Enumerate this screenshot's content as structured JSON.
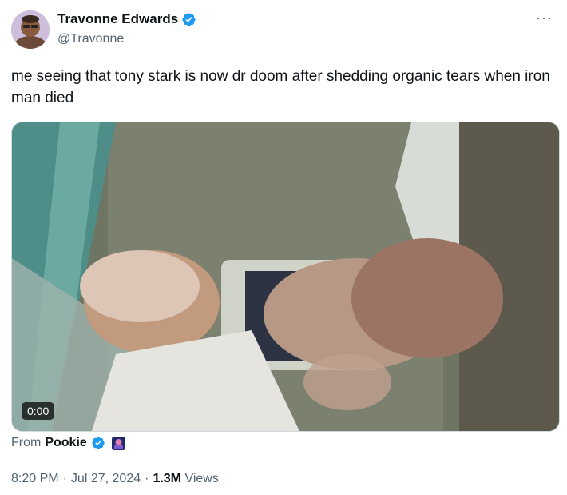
{
  "author": {
    "display_name": "Travonne Edwards",
    "handle": "@Travonne",
    "verified_icon": "verified-badge-icon"
  },
  "tweet": {
    "text": "me seeing that tony stark is now dr doom after shedding organic tears when iron man died"
  },
  "media": {
    "duration": "0:00"
  },
  "source": {
    "label": "From",
    "name": "Pookie"
  },
  "meta": {
    "time": "8:20 PM",
    "date": "Jul 27, 2024",
    "views_count": "1.3M",
    "views_label": "Views",
    "separator": "·"
  },
  "menu": {
    "more_label": "···"
  },
  "colors": {
    "verified": "#1d9bf0",
    "secondary_text": "#536471",
    "primary_text": "#0f1419"
  }
}
